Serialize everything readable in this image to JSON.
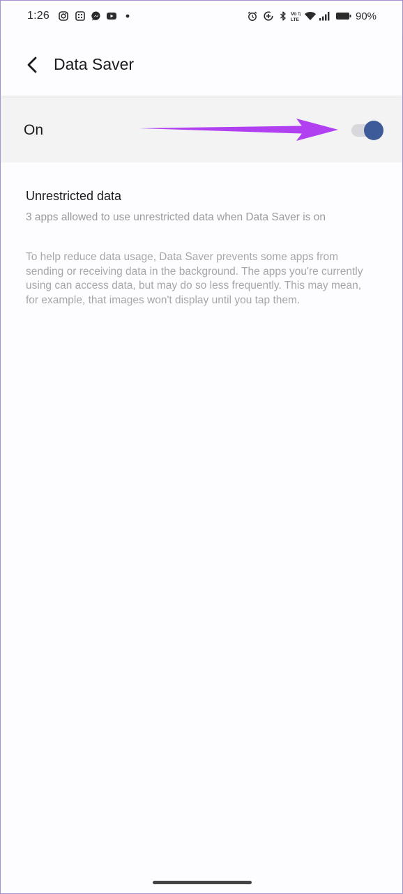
{
  "status_bar": {
    "time": "1:26",
    "battery_percent": "90%",
    "left_icons": [
      "instagram-icon",
      "calendar-grid-icon",
      "messenger-icon",
      "youtube-icon",
      "dot-icon"
    ],
    "right_icons": [
      "alarm-icon",
      "data-saver-icon",
      "bluetooth-icon",
      "volte-icon",
      "wifi-icon",
      "signal-icon",
      "battery-icon"
    ],
    "volte_text": "VoLTE"
  },
  "app_bar": {
    "title": "Data Saver",
    "back_icon": "arrow-back-icon"
  },
  "main_switch": {
    "label": "On",
    "checked": true,
    "thumb_color": "#3d5a99",
    "track_color": "#d7d7dc",
    "annotation_arrow_color": "#b040f0"
  },
  "unrestricted": {
    "title": "Unrestricted data",
    "summary": "3 apps allowed to use unrestricted data when Data Saver is on"
  },
  "footer": {
    "text": "To help reduce data usage, Data Saver prevents some apps from sending or receiving data in the background. The apps you're currently using can access data, but may do so less frequently. This may mean, for example, that images won't display until you tap them."
  }
}
